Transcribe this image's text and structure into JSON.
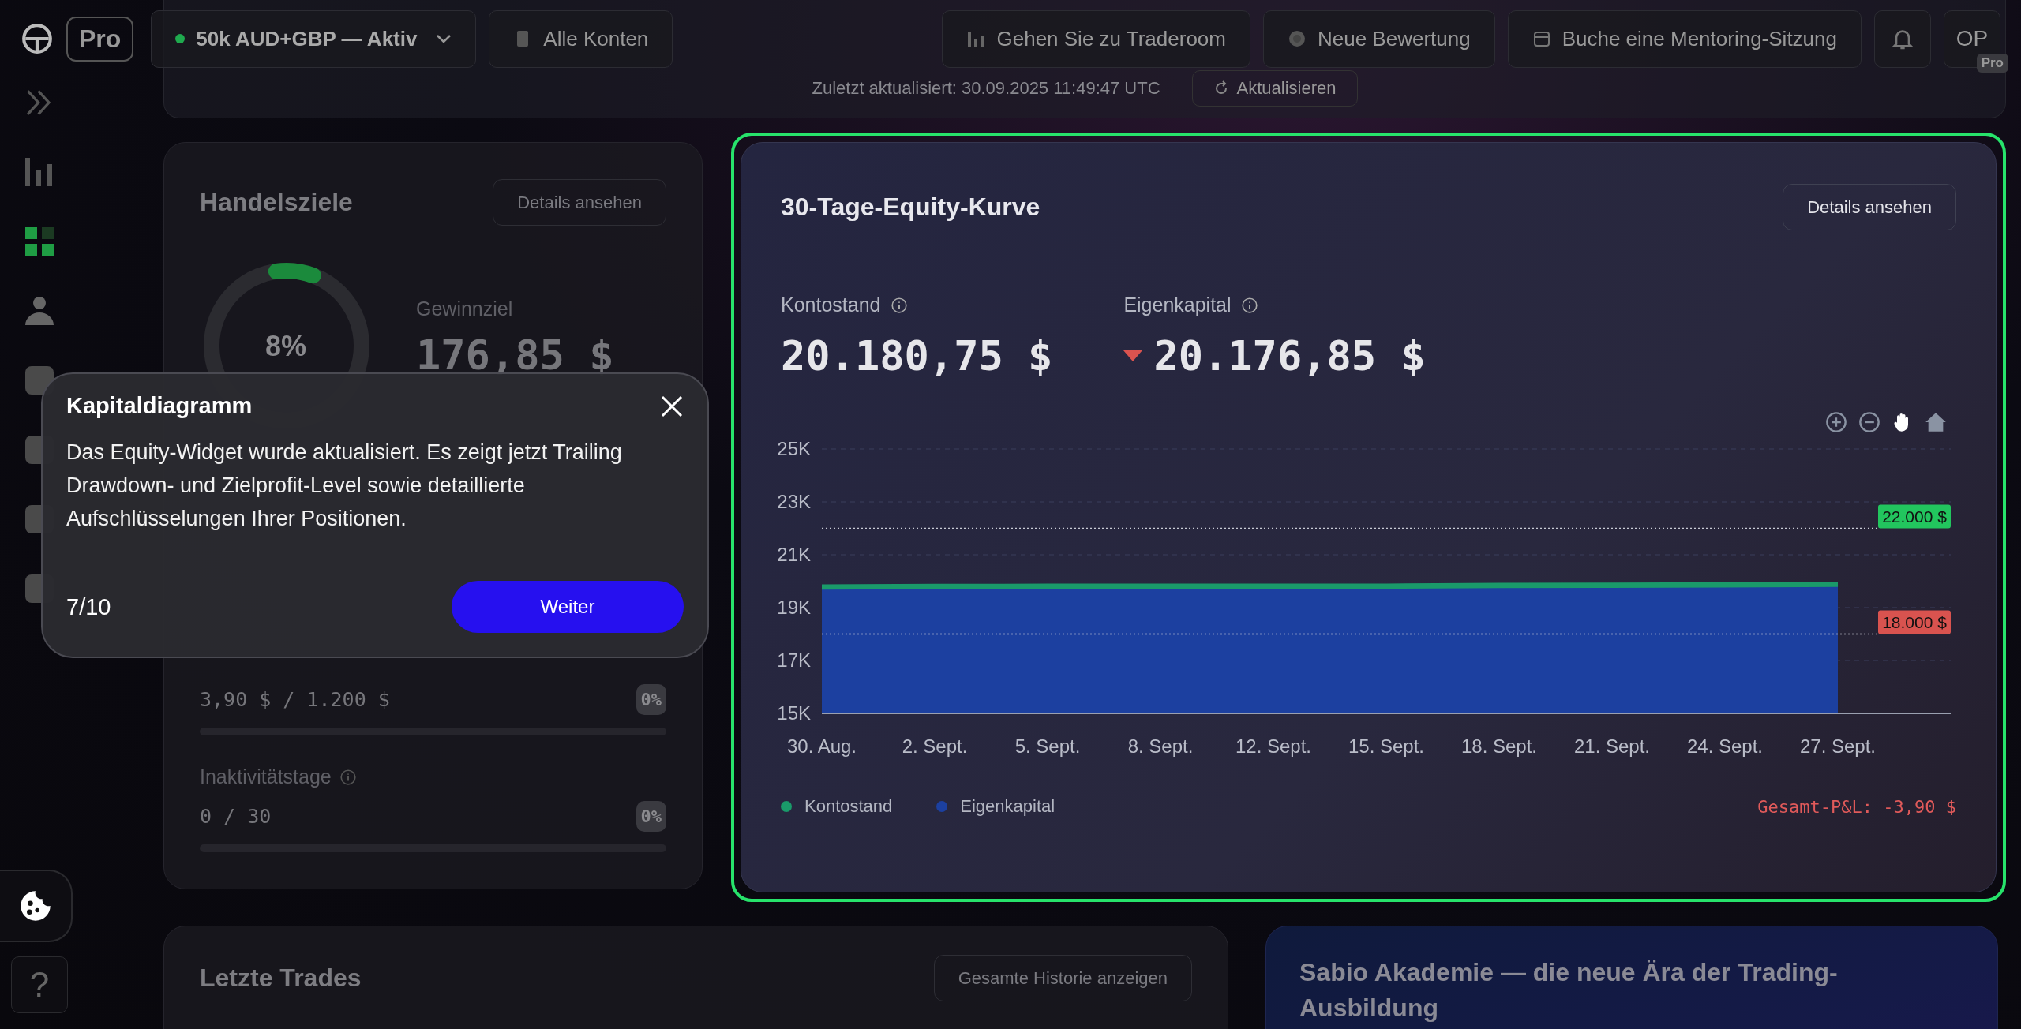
{
  "topbar": {
    "logo_badge": "Pro",
    "account": {
      "label": "50k AUD+GBP — Aktiv",
      "active": true
    },
    "all_accounts": "Alle Konten",
    "actions": [
      {
        "kind": "traderoom",
        "label": "Gehen Sie zu Traderoom"
      },
      {
        "kind": "evaluation",
        "label": "Neue Bewertung"
      },
      {
        "kind": "mentoring",
        "label": "Buche eine Mentoring-Sitzung"
      }
    ],
    "avatar": {
      "initials": "OP",
      "badge": "Pro"
    }
  },
  "status_panel": {
    "updated": "Zuletzt aktualisiert: 30.09.2025 11:49:47 UTC",
    "refresh": "Aktualisieren"
  },
  "sidebar": {
    "items": [
      {
        "kind": "chart",
        "selected": false
      },
      {
        "kind": "grid",
        "selected": true
      },
      {
        "kind": "person",
        "selected": false
      },
      {
        "kind": "generic",
        "selected": false
      },
      {
        "kind": "generic",
        "selected": false
      },
      {
        "kind": "generic",
        "selected": false
      },
      {
        "kind": "generic",
        "selected": false
      }
    ],
    "help": "?"
  },
  "goals": {
    "title": "Handelsziele",
    "details": "Details ansehen",
    "progress": {
      "label": "8%",
      "level": 0.08
    },
    "profit_label": "Gewinnziel",
    "profit_value": "176,85 $",
    "rows": [
      {
        "label": null,
        "value": "3,90 $ / 1.200 $",
        "percent": "0%",
        "level": 0
      },
      {
        "label": "Inaktivitätstage",
        "value": "0 / 30",
        "percent": "0%",
        "level": 0
      }
    ]
  },
  "equity": {
    "title": "30-Tage-Equity-Kurve",
    "details": "Details ansehen",
    "balance_label": "Kontostand",
    "balance": "20.180,75 $",
    "equity_label": "Eigenkapital",
    "equity_value": "20.176,85 $",
    "equity_falling": true,
    "chart_data": {
      "type": "area",
      "categories": [
        "30. Aug.",
        "2. Sept.",
        "5. Sept.",
        "8. Sept.",
        "12. Sept.",
        "15. Sept.",
        "18. Sept.",
        "21. Sept.",
        "24. Sept.",
        "27. Sept."
      ],
      "series": [
        {
          "name": "Kontostand",
          "color": "#1a9a6a",
          "values": [
            19880,
            19900,
            19910,
            19910,
            19910,
            19910,
            19940,
            19950,
            19960,
            19980
          ]
        },
        {
          "name": "Eigenkapital",
          "color": "#1c40a0",
          "values": [
            19680,
            19700,
            19710,
            19710,
            19710,
            19710,
            19740,
            19750,
            19760,
            19780
          ]
        }
      ],
      "ylim": [
        15000,
        25000
      ],
      "grid": true,
      "yticks": [
        {
          "value": 15000,
          "label": "15K"
        },
        {
          "value": 17000,
          "label": "17K"
        },
        {
          "value": 19000,
          "label": "19K"
        },
        {
          "value": 21000,
          "label": "21K"
        },
        {
          "value": 23000,
          "label": "23K"
        },
        {
          "value": 25000,
          "label": "25K"
        }
      ],
      "ref_lines": [
        {
          "axis": "y",
          "value": 22000,
          "label": "22.000 $",
          "color": "#c9ccd6"
        },
        {
          "axis": "y",
          "value": 18000,
          "label": "18.000 $",
          "color": "#c9ccd6"
        }
      ]
    },
    "total_pnl": "Gesamt-P&L: -3,90 $"
  },
  "trades": {
    "title": "Letzte Trades",
    "history": "Gesamte Historie anzeigen"
  },
  "academy": {
    "title": "Sabio Akademie — die neue Ära der Trading-Ausbildung"
  },
  "popup": {
    "title": "Kapitaldiagramm",
    "text": "Das Equity-Widget wurde aktualisiert. Es zeigt jetzt Trailing Drawdown- und Zielprofit-Level sowie detaillierte Aufschlüsselungen Ihrer Positionen.",
    "step": "7/10",
    "next": "Weiter"
  }
}
